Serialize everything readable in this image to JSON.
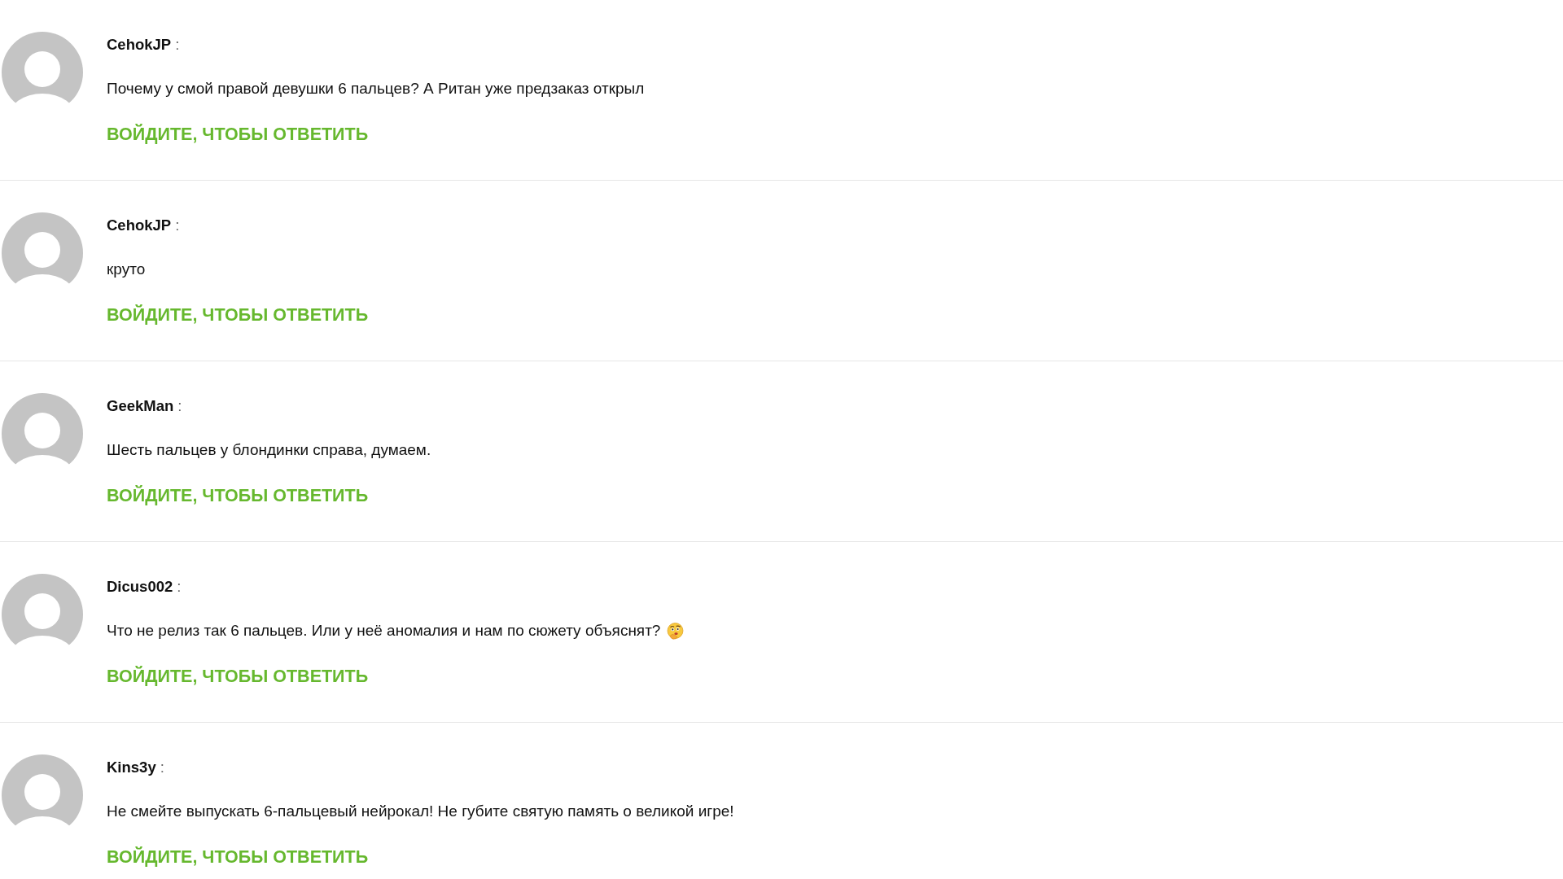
{
  "comments": [
    {
      "author": "CehokJP",
      "separator": ":",
      "text": "Почему у смой правой девушки 6 пальцев? А Ритан уже предзаказ открыл",
      "has_emoji": false,
      "reply_link": "ВОЙДИТЕ, ЧТОБЫ ОТВЕТИТЬ"
    },
    {
      "author": "CehokJP",
      "separator": ":",
      "text": "круто",
      "has_emoji": false,
      "reply_link": "ВОЙДИТЕ, ЧТОБЫ ОТВЕТИТЬ"
    },
    {
      "author": "GeekMan",
      "separator": ":",
      "text": "Шесть пальцев у блондинки справа, думаем.",
      "has_emoji": false,
      "reply_link": "ВОЙДИТЕ, ЧТОБЫ ОТВЕТИТЬ"
    },
    {
      "author": "Dicus002",
      "separator": ":",
      "text": "Что не релиз так 6 пальцев. Или у неё аномалия и нам по сюжету объяснят?",
      "has_emoji": true,
      "reply_link": "ВОЙДИТЕ, ЧТОБЫ ОТВЕТИТЬ"
    },
    {
      "author": "Kins3y",
      "separator": ":",
      "text": "Не смейте выпускать 6-пальцевый нейрокал! Не губите святую память о великой игре!",
      "has_emoji": false,
      "reply_link": "ВОЙДИТЕ, ЧТОБЫ ОТВЕТИТЬ"
    }
  ]
}
